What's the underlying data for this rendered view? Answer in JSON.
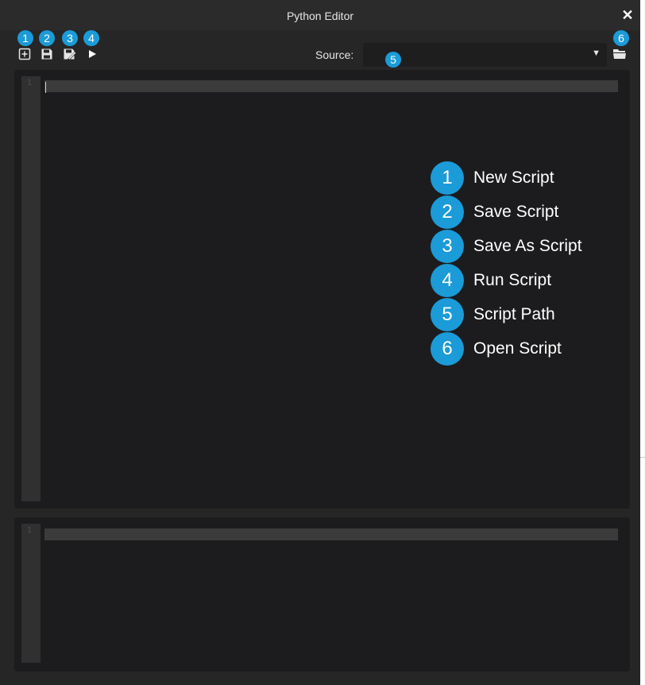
{
  "window": {
    "title": "Python Editor",
    "close_symbol": "✕"
  },
  "toolbar": {
    "buttons": [
      {
        "name": "new-script",
        "icon": "plus-square-icon",
        "badge": "1"
      },
      {
        "name": "save-script",
        "icon": "floppy-disk-icon",
        "badge": "2"
      },
      {
        "name": "save-as-script",
        "icon": "save-as-icon",
        "badge": "3"
      },
      {
        "name": "run-script",
        "icon": "play-icon",
        "badge": "4"
      }
    ],
    "source_label": "Source:",
    "source_badge": "5",
    "source_value": "",
    "dropdown_symbol": "▼",
    "open_badge": "6",
    "open_icon": "folder-open-icon"
  },
  "editor": {
    "line_numbers": [
      "1"
    ]
  },
  "output": {
    "line_numbers": [
      "1"
    ]
  },
  "legend": {
    "items": [
      {
        "num": "1",
        "label": "New Script"
      },
      {
        "num": "2",
        "label": "Save Script"
      },
      {
        "num": "3",
        "label": "Save As Script"
      },
      {
        "num": "4",
        "label": "Run Script"
      },
      {
        "num": "5",
        "label": "Script Path"
      },
      {
        "num": "6",
        "label": "Open Script"
      }
    ]
  },
  "colors": {
    "accent": "#1b9bd8",
    "window_bg": "#262626",
    "editor_bg": "#1c1c1e",
    "gutter_bg": "#303030",
    "line_highlight": "#3b3b3b"
  }
}
